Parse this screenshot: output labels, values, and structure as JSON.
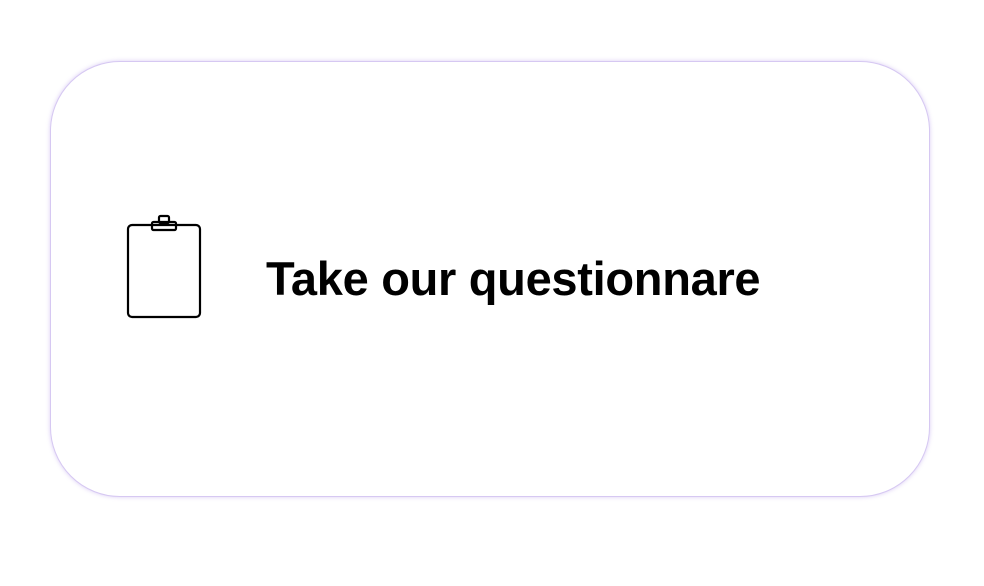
{
  "card": {
    "label": "Take our questionnare",
    "icon": "clipboard-icon",
    "border_color": "#d6c8f2",
    "text_color": "#000000"
  }
}
